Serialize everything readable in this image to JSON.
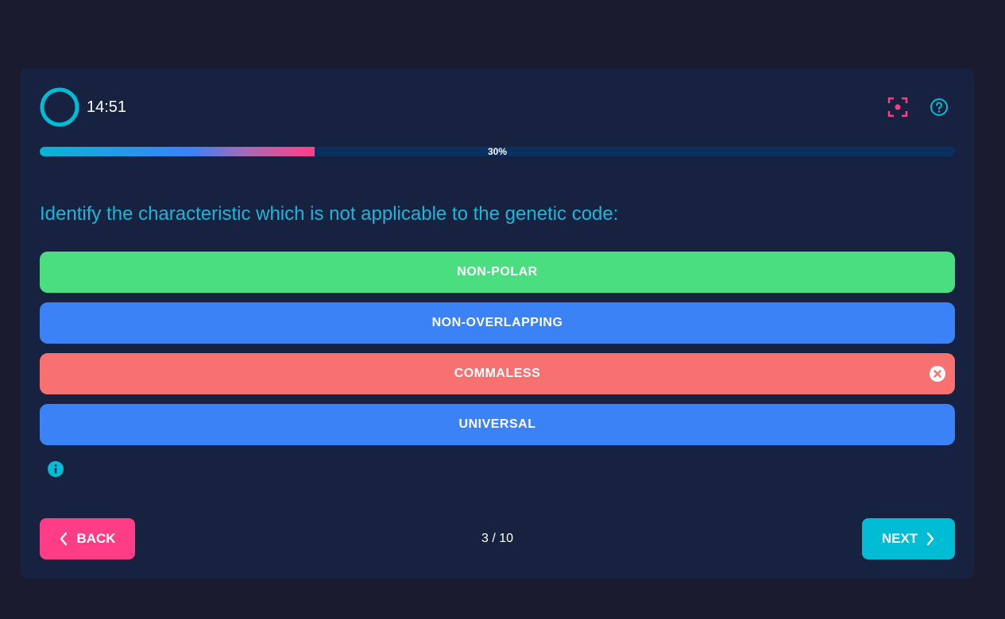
{
  "timer": {
    "text": "14:51"
  },
  "progress": {
    "percent": 30,
    "label": "30%"
  },
  "question": {
    "text": "Identify the characteristic which is not applicable to the genetic code:"
  },
  "options": [
    {
      "label": "NON-POLAR",
      "state": "correct"
    },
    {
      "label": "NON-OVERLAPPING",
      "state": "neutral"
    },
    {
      "label": "COMMALESS",
      "state": "wrong"
    },
    {
      "label": "UNIVERSAL",
      "state": "neutral"
    }
  ],
  "navigation": {
    "back_label": "BACK",
    "next_label": "NEXT",
    "counter": "3 / 10"
  },
  "icons": {
    "timer": "timer-ring-icon",
    "focus": "focus-mode-icon",
    "help": "help-circle-icon",
    "wrong": "close-circle-icon",
    "info": "info-icon",
    "back": "chevron-left-icon",
    "next": "chevron-right-icon"
  },
  "colors": {
    "background": "#1a1b2e",
    "card": "#172240",
    "accent_cyan": "#00bcd4",
    "accent_pink": "#ff3d86",
    "correct": "#4ade80",
    "neutral": "#3b82f6",
    "wrong": "#f87171"
  }
}
